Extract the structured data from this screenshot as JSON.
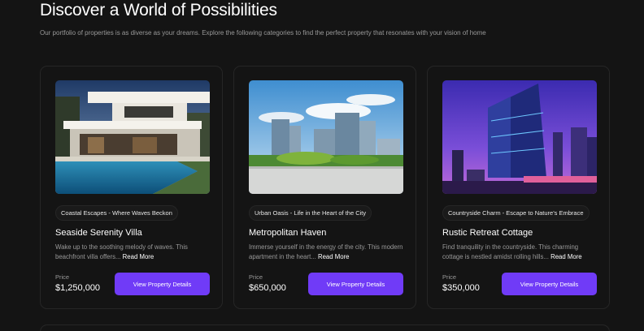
{
  "header": {
    "title": "Discover a World of Possibilities",
    "subtitle": "Our portfolio of properties is as diverse as your dreams. Explore the following categories to find the perfect property that resonates with your vision of home"
  },
  "colors": {
    "background": "#141414",
    "card_border": "#262626",
    "accent": "#703BF7",
    "muted_text": "#999999"
  },
  "cards": [
    {
      "image": "modern-villa-pool-photo",
      "tag": "Coastal Escapes - Where Waves Beckon",
      "title": "Seaside Serenity Villa",
      "description": "Wake up to the soothing melody of waves. This beachfront villa offers...",
      "read_more": "Read More",
      "price_label": "Price",
      "price": "$1,250,000",
      "button": "View Property Details"
    },
    {
      "image": "city-skyline-buildings-photo",
      "tag": "Urban Oasis - Life in the Heart of the City",
      "title": "Metropolitan Haven",
      "description": "Immerse yourself in the energy of the city. This modern apartment in the heart...",
      "read_more": "Read More",
      "price_label": "Price",
      "price": "$650,000",
      "button": "View Property Details"
    },
    {
      "image": "night-glass-tower-photo",
      "tag": "Countryside Charm - Escape to Nature's Embrace",
      "title": "Rustic Retreat Cottage",
      "description": "Find tranquility in the countryside. This charming cottage is nestled amidst rolling hills...",
      "read_more": "Read More",
      "price_label": "Price",
      "price": "$350,000",
      "button": "View Property Details"
    }
  ]
}
